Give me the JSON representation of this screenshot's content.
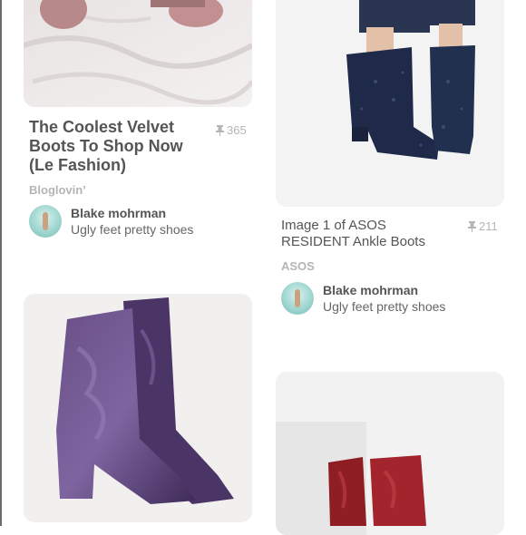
{
  "pins": [
    {
      "title": "The Coolest Velvet Boots To Shop Now (Le Fashion)",
      "saves": "365",
      "source": "Bloglovin’",
      "pinner": "Blake mohrman",
      "board": "Ugly feet pretty shoes",
      "image": "bedsheet-velvet-slippers"
    },
    {
      "title": "Image 1 of ASOS RESIDENT Ankle Boots",
      "saves": "211",
      "source": "ASOS",
      "pinner": "Blake mohrman",
      "board": "Ugly feet pretty shoes",
      "image": "navy-glitter-ankle-boots"
    },
    {
      "image": "purple-velvet-ankle-boots"
    },
    {
      "image": "red-velvet-ankle-boots"
    }
  ],
  "icons": {
    "save_icon": "pushpin-icon"
  },
  "colors": {
    "card_bg": "#f1f0ef",
    "muted_text": "#b5b5b5",
    "title_text": "#555555"
  }
}
